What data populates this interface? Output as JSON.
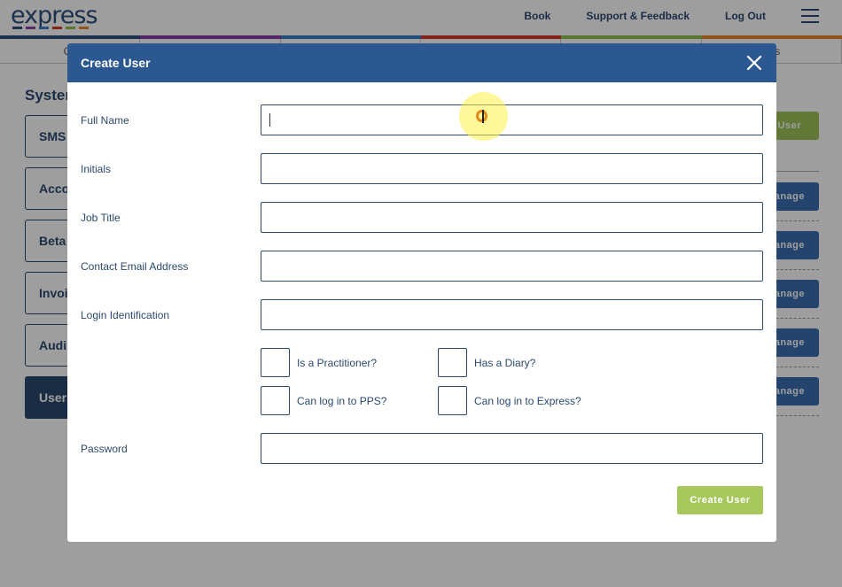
{
  "app": {
    "logo_text": "express",
    "logo_dash_colors": [
      "#2c4f7c",
      "#8b3fa8",
      "#3a7dc9",
      "#d9382e",
      "#8cc04a",
      "#e8892b"
    ],
    "nav": {
      "book": "Book",
      "support": "Support & Feedback",
      "logout": "Log Out"
    },
    "colorbar_colors": [
      "#2c4f7c",
      "#8b3fa8",
      "#3a7dc9",
      "#d9382e",
      "#8cc04a",
      "#e8892b"
    ],
    "subtabs": [
      "Cli",
      "",
      "",
      "",
      "",
      "orts"
    ],
    "section_title": "Syster",
    "side_buttons": [
      "SMS",
      "Acco",
      "Beta",
      "Invoi",
      "Audi",
      "Users"
    ],
    "add_user_label": "User",
    "manage_label": "anage"
  },
  "modal": {
    "title": "Create User",
    "fields": {
      "full_name": {
        "label": "Full Name",
        "value": ""
      },
      "initials": {
        "label": "Initials",
        "value": ""
      },
      "job_title": {
        "label": "Job Title",
        "value": ""
      },
      "email": {
        "label": "Contact Email Address",
        "value": ""
      },
      "login_id": {
        "label": "Login Identification",
        "value": ""
      },
      "password": {
        "label": "Password",
        "value": ""
      }
    },
    "checkboxes": {
      "practitioner": {
        "label": "Is a Practitioner?",
        "checked": false
      },
      "diary": {
        "label": "Has a Diary?",
        "checked": false
      },
      "pps": {
        "label": "Can log in to PPS?",
        "checked": false
      },
      "express": {
        "label": "Can log in to Express?",
        "checked": false
      }
    },
    "submit_label": "Create User"
  },
  "colors": {
    "header": "#2c5891",
    "text": "#2b4a70",
    "submit": "#a6c85d"
  }
}
